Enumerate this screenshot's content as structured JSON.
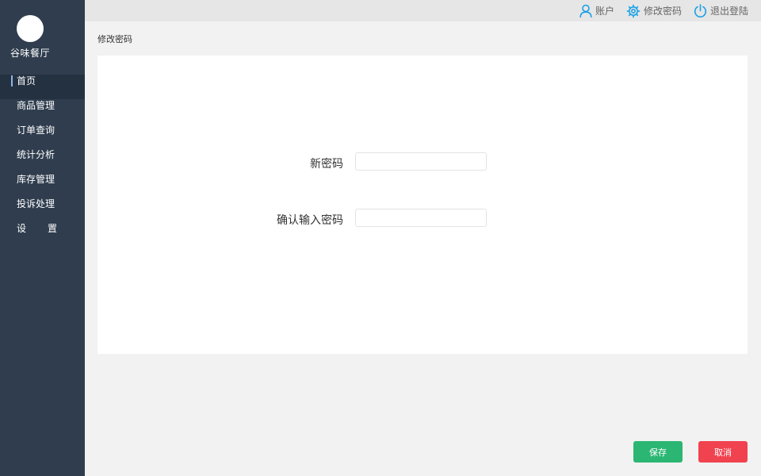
{
  "sidebar": {
    "brand": "谷味餐厅",
    "items": [
      {
        "label": "首页",
        "active": true
      },
      {
        "label": "商品管理"
      },
      {
        "label": "订单查询"
      },
      {
        "label": "统计分析"
      },
      {
        "label": "库存管理"
      },
      {
        "label": "投诉处理"
      },
      {
        "label": "设置"
      }
    ]
  },
  "topbar": {
    "account_label": "账户",
    "change_password_label": "修改密码",
    "logout_label": "退出登陆"
  },
  "breadcrumb": "修改密码",
  "form": {
    "new_password": {
      "label": "新密码",
      "value": "",
      "placeholder": ""
    },
    "confirm_password": {
      "label": "确认输入密码",
      "value": "",
      "placeholder": ""
    }
  },
  "actions": {
    "save_label": "保存",
    "cancel_label": "取消"
  },
  "colors": {
    "sidebar_bg": "#2f3d4e",
    "icon_accent": "#1aa0e6",
    "save": "#2bb673",
    "cancel": "#f0434f"
  }
}
